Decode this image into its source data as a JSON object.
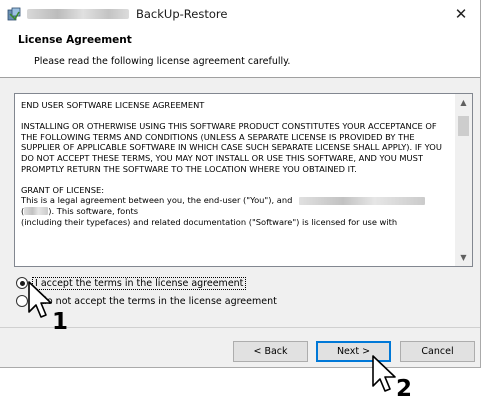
{
  "window": {
    "title": "BackUp-Restore",
    "close_glyph": "✕"
  },
  "header": {
    "heading": "License Agreement",
    "subheading": "Please read the following license agreement carefully."
  },
  "license": {
    "line_title": "END USER SOFTWARE LICENSE AGREEMENT",
    "para1": "INSTALLING OR OTHERWISE USING THIS SOFTWARE PRODUCT CONSTITUTES YOUR ACCEPTANCE OF THE FOLLOWING TERMS AND CONDITIONS (UNLESS A SEPARATE LICENSE IS PROVIDED BY THE SUPPLIER OF APPLICABLE SOFTWARE IN WHICH CASE SUCH SEPARATE LICENSE SHALL APPLY). IF YOU DO NOT ACCEPT THESE TERMS, YOU MAY NOT INSTALL OR USE THIS SOFTWARE, AND YOU MUST PROMPTLY RETURN THE SOFTWARE TO THE LOCATION WHERE YOU OBTAINED IT.",
    "grant_heading": "GRANT OF LICENSE:",
    "grant_line1": "This is a legal agreement between you, the end-user (\"You\"), and",
    "grant_line2_open": "(",
    "grant_line2_rest": "). This software, fonts",
    "grant_line3": "(including their typefaces) and related documentation (\"Software\") is licensed for use with"
  },
  "options": {
    "accept_label": "I accept the terms in the license agreement",
    "decline_label": "I do not accept the terms in the license agreement",
    "selected": "accept"
  },
  "buttons": {
    "back": "< Back",
    "next": "Next >",
    "cancel": "Cancel"
  },
  "annotations": {
    "step1": "1",
    "step2": "2"
  }
}
